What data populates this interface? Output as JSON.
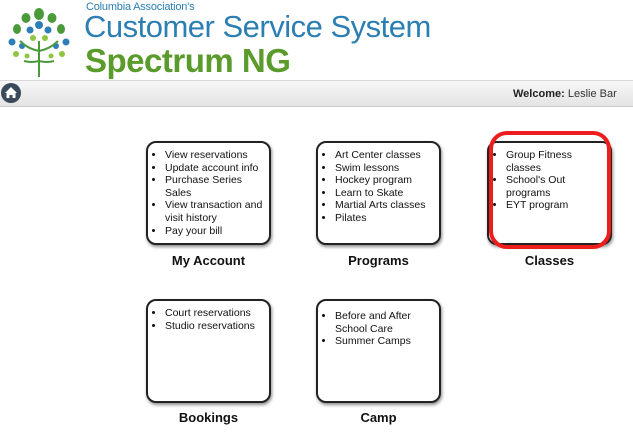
{
  "header": {
    "association": "Columbia Association's",
    "title_line1": "Customer Service System",
    "title_line2": "Spectrum NG"
  },
  "navbar": {
    "welcome_label": "Welcome:",
    "welcome_user": "Leslie Bar"
  },
  "cards": [
    {
      "label": "My Account",
      "items": [
        "View reservations",
        "Update account info",
        "Purchase Series Sales",
        "View transaction and visit history",
        "Pay your bill"
      ]
    },
    {
      "label": "Programs",
      "items": [
        "Art Center classes",
        "Swim lessons",
        "Hockey program",
        "Learn to Skate",
        "Martial Arts classes",
        "Pilates"
      ]
    },
    {
      "label": "Classes",
      "items": [
        "Group Fitness classes",
        "School's Out programs",
        "EYT program"
      ]
    },
    {
      "label": "Bookings",
      "items": [
        "Court reservations",
        "Studio reservations"
      ]
    },
    {
      "label": "Camp",
      "items": [
        "Before and After School Care",
        "Summer Camps"
      ]
    }
  ],
  "colors": {
    "brand_blue": "#2c7fb3",
    "brand_green": "#5a9b2c",
    "highlight_red": "#ee1d1d"
  },
  "icons": {
    "logo": "columbia-association-logo",
    "home": "home-icon"
  }
}
